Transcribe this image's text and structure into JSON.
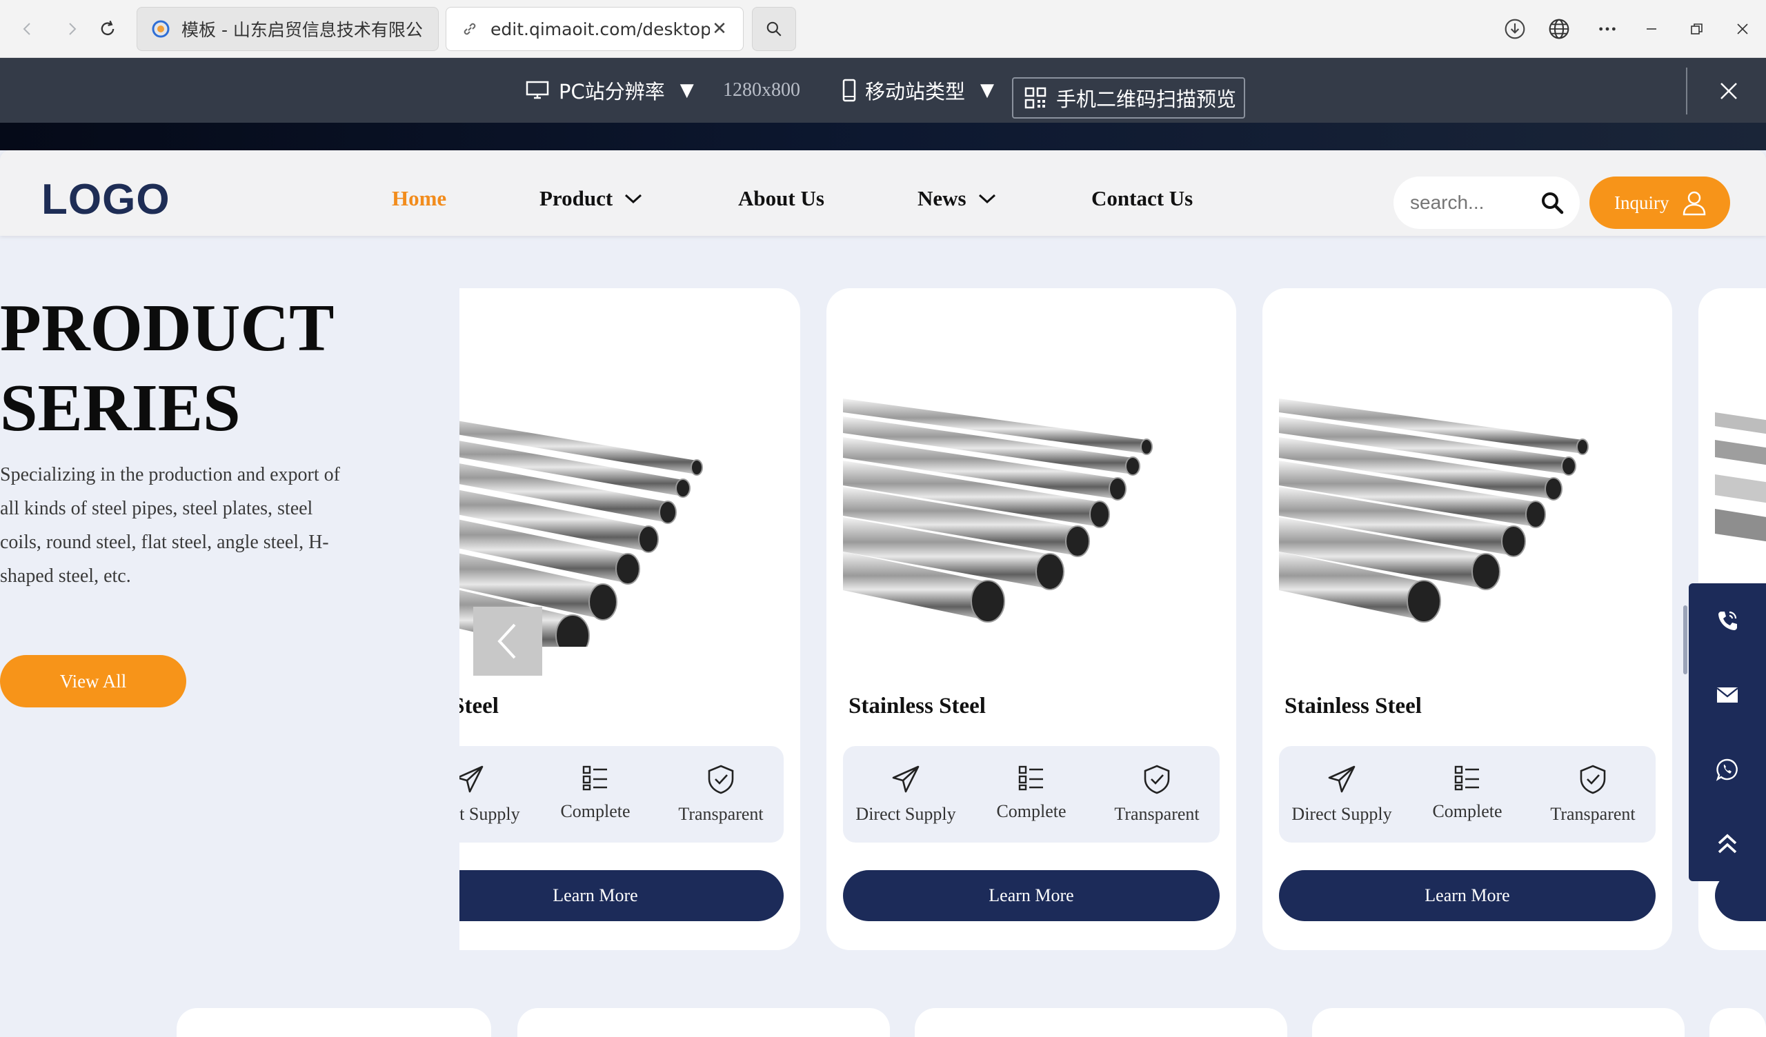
{
  "browser": {
    "tabs": [
      {
        "title": "模板 - 山东启贸信息技术有限公司",
        "active": false
      },
      {
        "title": "edit.qimaoit.com/desktop/h",
        "active": true
      }
    ],
    "icons": [
      "back-icon",
      "forward-icon",
      "reload-icon",
      "search-icon",
      "download-icon",
      "globe-icon",
      "more-icon",
      "minimize-icon",
      "restore-icon",
      "close-icon"
    ]
  },
  "preview_toolbar": {
    "pc_label": "PC站分辨率",
    "resolution": "1280x800",
    "mobile_label": "移动站类型",
    "qr_label": "手机二维码扫描预览"
  },
  "header": {
    "logo": "LOGO",
    "menu": [
      {
        "label": "Home",
        "active": true,
        "dropdown": false
      },
      {
        "label": "Product",
        "active": false,
        "dropdown": true
      },
      {
        "label": "About Us",
        "active": false,
        "dropdown": false
      },
      {
        "label": "News",
        "active": false,
        "dropdown": true
      },
      {
        "label": "Contact Us",
        "active": false,
        "dropdown": false
      }
    ],
    "search_placeholder": "search...",
    "inquiry_label": "Inquiry",
    "accent_color": "#f79419",
    "brand_color": "#1c2b59"
  },
  "product_series": {
    "title": "PRODUCT\nSERIES",
    "description": "Specializing in the production and export of all kinds of steel pipes, steel plates, steel coils, round steel, flat steel, angle steel, H-shaped steel, etc.",
    "view_all_label": "View All",
    "cards": [
      {
        "title": "Stainless Steel",
        "features": [
          "Direct Supply",
          "Complete",
          "Transparent"
        ],
        "button": "Learn More"
      },
      {
        "title": "Stainless Steel",
        "features": [
          "Direct Supply",
          "Complete",
          "Transparent"
        ],
        "button": "Learn More"
      },
      {
        "title": "Stainless Steel",
        "features": [
          "Direct Supply",
          "Complete",
          "Transparent"
        ],
        "button": "Learn More"
      }
    ]
  },
  "floating_contact": {
    "icons": [
      "phone-icon",
      "mail-icon",
      "whatsapp-icon",
      "back-to-top-icon"
    ]
  }
}
